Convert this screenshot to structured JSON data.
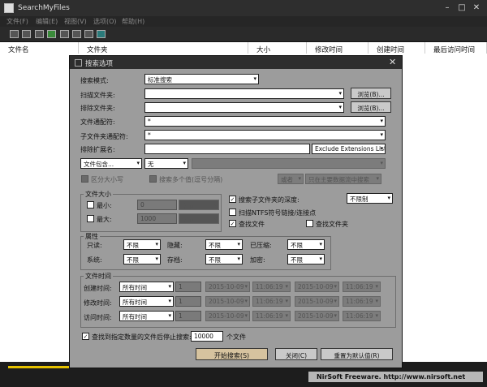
{
  "window": {
    "title": "SearchMyFiles"
  },
  "menu": [
    "文件(F)",
    "编辑(E)",
    "视图(V)",
    "选项(O)",
    "帮助(H)"
  ],
  "columns": [
    "文件名",
    "文件夹",
    "大小",
    "修改时间",
    "创建时间",
    "最后访问时间"
  ],
  "status": {
    "brand": "NirSoft Freeware.  http://www.nirsoft.net"
  },
  "dialog": {
    "title": "搜索选项",
    "search_mode_label": "搜索模式:",
    "search_mode_value": "标准搜索",
    "base_folders_label": "扫描文件夹:",
    "exclude_folders_label": "排除文件夹:",
    "browse_label": "浏览(B)...",
    "files_wildcard_label": "文件通配符:",
    "files_wildcard_value": "*",
    "subfolders_wildcard_label": "子文件夹通配符:",
    "subfolders_wildcard_value": "*",
    "exclude_ext_label": "排除扩展名:",
    "exclude_ext_mode": "Exclude Extensions List",
    "contains_mode": "文件包含...",
    "contains_type": "无",
    "case_sensitive": "区分大小写",
    "multiple_values": "搜索多个值(逗号分隔)",
    "find_label": "或者",
    "find_major": "只在主要数据流中搜索",
    "file_size_group": "文件大小",
    "min_label": "最小:",
    "min_value": "0",
    "max_label": "最大:",
    "max_value": "1000",
    "size_unit": "字节",
    "subfolder_depth_label": "搜索子文件夹的深度:",
    "subfolder_depth_value": "不限制",
    "ntfs_label": "扫描NTFS符号链接/连接点",
    "find_files_label": "查找文件",
    "find_folders_label": "查找文件夹",
    "attributes_group": "属性",
    "readonly_label": "只读:",
    "hidden_label": "隐藏:",
    "compressed_label": "已压缩:",
    "system_label": "系统:",
    "archive_label": "存档:",
    "encrypted_label": "加密:",
    "attr_value": "不限",
    "file_time_group": "文件时间",
    "created_label": "创建时间:",
    "modified_label": "修改时间:",
    "accessed_label": "访问时间:",
    "all_times": "所有时间",
    "time_num": "1",
    "date_value": "2015-10-09",
    "time_value": "11:06:19",
    "stop_label": "查找到指定数量的文件后停止搜索:",
    "stop_value": "10000",
    "stop_unit": "个文件",
    "start_button": "开始搜索(S)",
    "close_button": "关闭(C)",
    "reset_button": "重置为默认值(R)"
  },
  "icons": [
    "app-icon",
    "new-file-icon",
    "open-folder-icon",
    "save-icon",
    "refresh-icon",
    "copy-icon",
    "properties-icon",
    "search-options-icon",
    "exit-icon"
  ]
}
